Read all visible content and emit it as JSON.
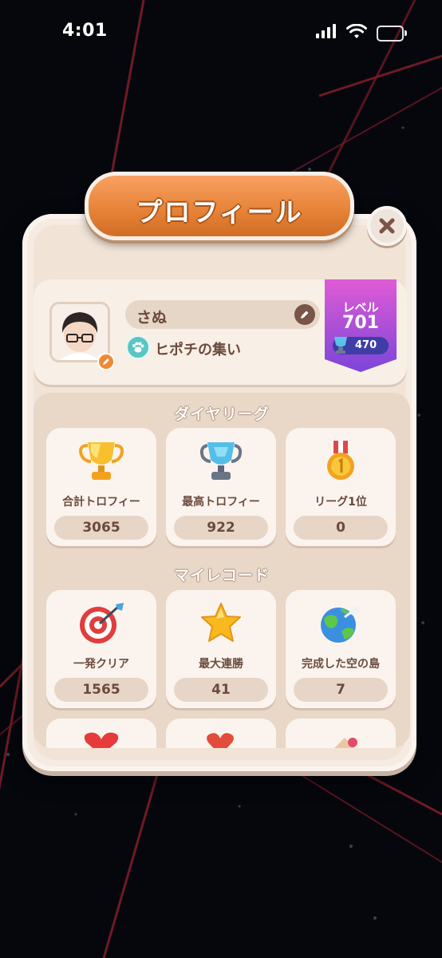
{
  "status_bar": {
    "time": "4:01"
  },
  "title": "プロフィール",
  "profile": {
    "name": "さぬ",
    "club": "ヒポチの集い",
    "level_label": "レベル",
    "level": "701",
    "trophies": "470"
  },
  "league": {
    "title": "ダイヤリーグ",
    "stats": [
      {
        "label": "合計トロフィー",
        "value": "3065",
        "icon": "gold-trophy-icon"
      },
      {
        "label": "最高トロフィー",
        "value": "922",
        "icon": "diamond-trophy-icon"
      },
      {
        "label": "リーグ1位",
        "value": "0",
        "icon": "gold-medal-icon"
      }
    ]
  },
  "records": {
    "title": "マイレコード",
    "stats": [
      {
        "label": "一発クリア",
        "value": "1565",
        "icon": "target-icon"
      },
      {
        "label": "最大連勝",
        "value": "41",
        "icon": "star-icon"
      },
      {
        "label": "完成した空の島",
        "value": "7",
        "icon": "planet-icon"
      }
    ]
  },
  "colors": {
    "accent": "#e58236",
    "panel": "#f5ebe2",
    "level_badge": "#9b4fd8"
  }
}
